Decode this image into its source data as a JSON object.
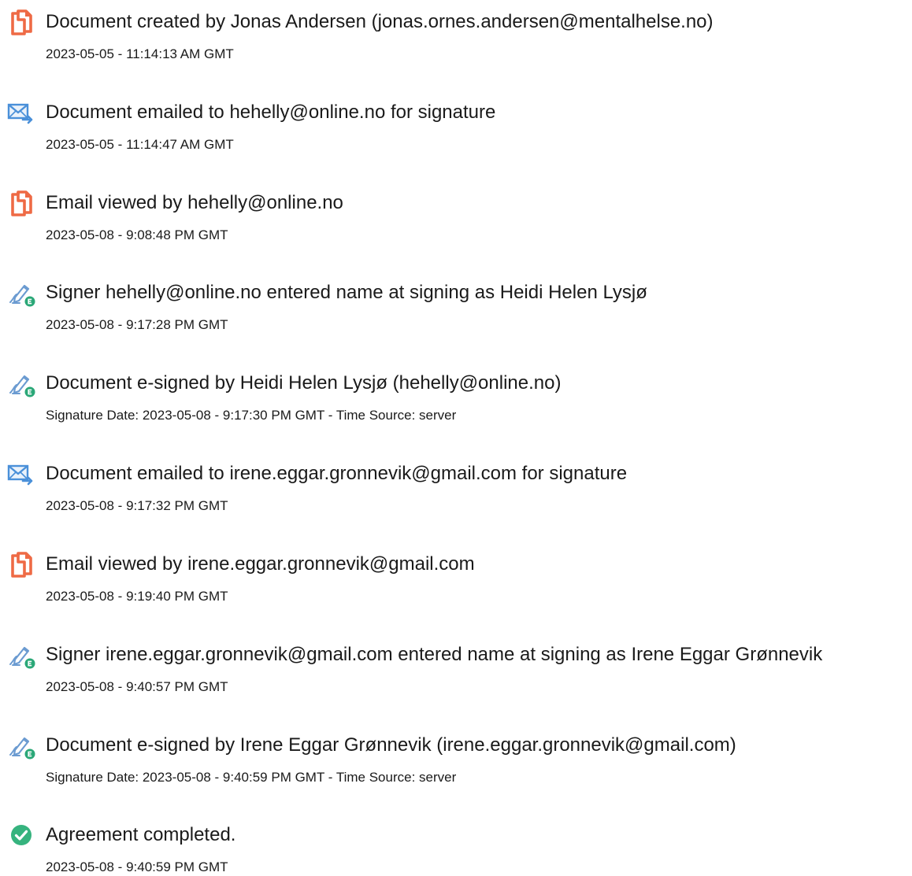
{
  "events": [
    {
      "icon": "document-icon",
      "title": "Document created by Jonas Andersen (jonas.ornes.andersen@mentalhelse.no)",
      "time": "2023-05-05 - 11:14:13 AM GMT"
    },
    {
      "icon": "email-sent-icon",
      "title": "Document emailed to hehelly@online.no for signature",
      "time": "2023-05-05 - 11:14:47 AM GMT"
    },
    {
      "icon": "document-icon",
      "title": "Email viewed by hehelly@online.no",
      "time": "2023-05-08 - 9:08:48 PM GMT"
    },
    {
      "icon": "pen-signature-icon",
      "title": "Signer hehelly@online.no entered name at signing as Heidi Helen Lysjø",
      "time": "2023-05-08 - 9:17:28 PM GMT"
    },
    {
      "icon": "pen-signature-icon",
      "title": "Document e-signed by Heidi Helen Lysjø (hehelly@online.no)",
      "time": "Signature Date: 2023-05-08 - 9:17:30 PM GMT - Time Source: server"
    },
    {
      "icon": "email-sent-icon",
      "title": "Document emailed to irene.eggar.gronnevik@gmail.com for signature",
      "time": "2023-05-08 - 9:17:32 PM GMT"
    },
    {
      "icon": "document-icon",
      "title": "Email viewed by irene.eggar.gronnevik@gmail.com",
      "time": "2023-05-08 - 9:19:40 PM GMT"
    },
    {
      "icon": "pen-signature-icon",
      "title": "Signer irene.eggar.gronnevik@gmail.com entered name at signing as Irene Eggar Grønnevik",
      "time": "2023-05-08 - 9:40:57 PM GMT"
    },
    {
      "icon": "pen-signature-icon",
      "title": "Document e-signed by Irene Eggar Grønnevik (irene.eggar.gronnevik@gmail.com)",
      "time": "Signature Date: 2023-05-08 - 9:40:59 PM GMT - Time Source: server"
    },
    {
      "icon": "check-circle-icon",
      "title": "Agreement completed.",
      "time": "2023-05-08 - 9:40:59 PM GMT"
    }
  ],
  "colors": {
    "document_icon": "#ee6a45",
    "email_icon": "#4a90d9",
    "pen_icon": "#6b9bd1",
    "badge_green": "#2aa777",
    "check_green": "#36b37e",
    "text": "#1a1a1a"
  }
}
